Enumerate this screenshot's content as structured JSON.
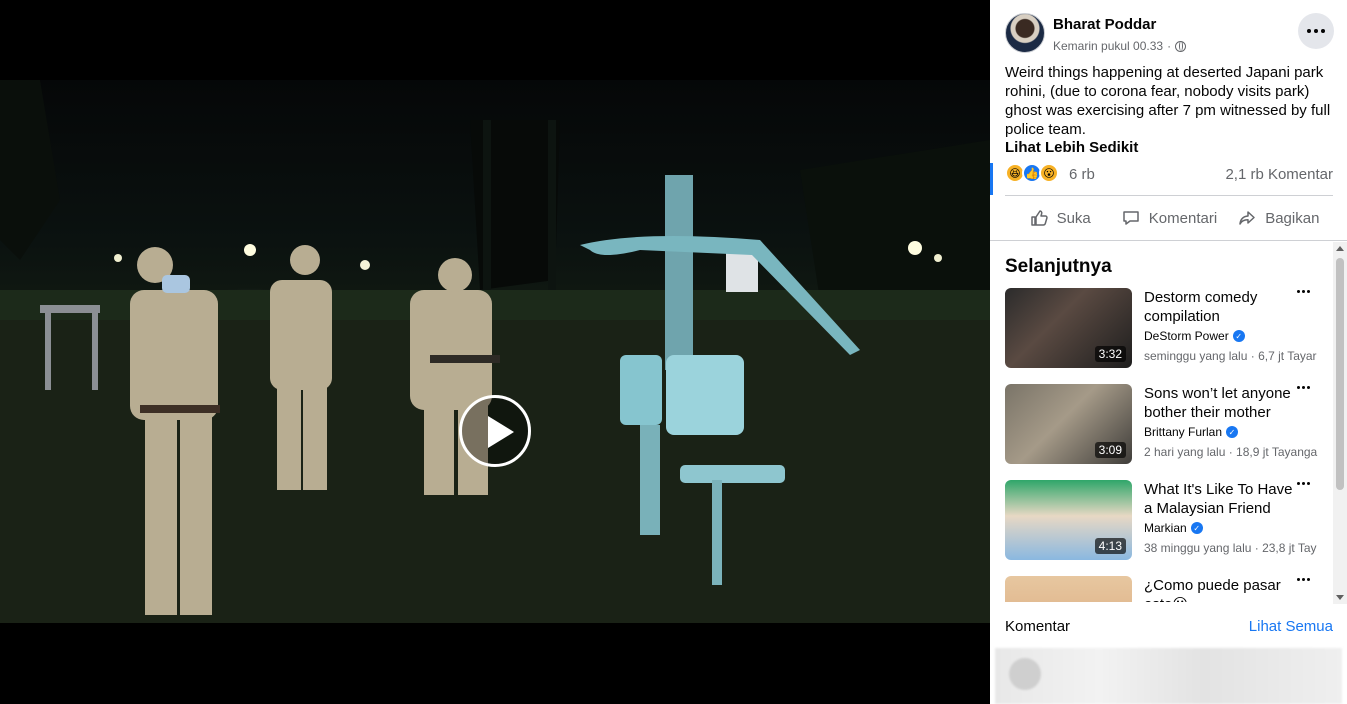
{
  "post": {
    "author": "Bharat Poddar",
    "timestamp": "Kemarin pukul 00.33",
    "text": "Weird things happening at deserted Japani park rohini, (due to corona fear, nobody visits park) ghost was exercising after 7 pm witnessed by full police team.",
    "see_less": "Lihat Lebih Sedikit",
    "reaction_icons": [
      "haha",
      "like",
      "wow"
    ],
    "reaction_count": "6 rb",
    "comment_count": "2,1 rb Komentar"
  },
  "actions": {
    "like": "Suka",
    "comment": "Komentari",
    "share": "Bagikan"
  },
  "up_next": {
    "title": "Selanjutnya",
    "items": [
      {
        "title": "Destorm comedy compilation",
        "channel": "DeStorm Power",
        "verified": true,
        "meta": "seminggu yang lalu · 6,7 jt Tayar",
        "duration": "3:32"
      },
      {
        "title": "Sons won’t let anyone bother their mother",
        "channel": "Brittany Furlan",
        "verified": true,
        "meta": "2 hari yang lalu · 18,9 jt Tayanga",
        "duration": "3:09"
      },
      {
        "title": "What It's Like To Have a Malaysian Friend",
        "channel": "Markian",
        "verified": true,
        "meta": "38 minggu yang lalu · 23,8 jt Tay",
        "duration": "4:13"
      },
      {
        "title": "¿Como puede pasar esto😮",
        "channel": "",
        "verified": false,
        "meta": "",
        "duration": ""
      }
    ]
  },
  "comments": {
    "label": "Komentar",
    "see_all": "Lihat Semua"
  }
}
